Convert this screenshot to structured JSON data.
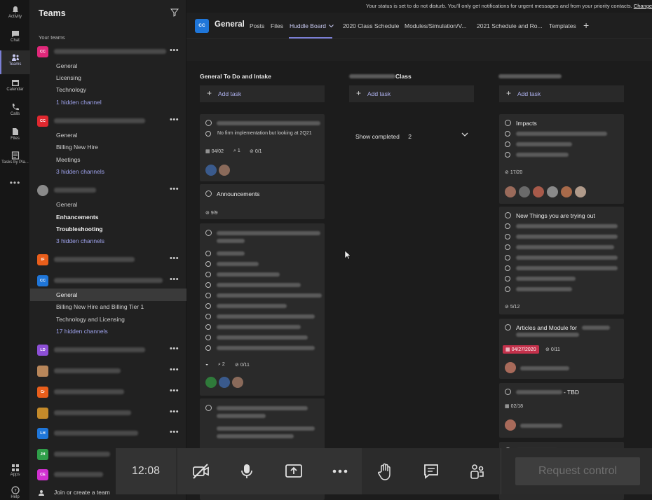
{
  "notification": {
    "text": "Your status is set to do not disturb. You'll only get notifications for urgent messages and from your priority contacts.",
    "link": "Change"
  },
  "rail": {
    "items": [
      {
        "label": "Activity",
        "icon": "bell-icon"
      },
      {
        "label": "Chat",
        "icon": "chat-icon"
      },
      {
        "label": "Teams",
        "icon": "teams-icon"
      },
      {
        "label": "Calendar",
        "icon": "calendar-icon"
      },
      {
        "label": "Calls",
        "icon": "phone-icon"
      },
      {
        "label": "Files",
        "icon": "file-icon"
      },
      {
        "label": "Tasks by Pla...",
        "icon": "tasks-icon"
      }
    ],
    "more": "•••",
    "apps": "Apps",
    "help": "Help"
  },
  "teams_panel": {
    "title": "Teams",
    "section": "Your teams",
    "teams": [
      {
        "initials": "CC",
        "color": "#e0287a"
      },
      {
        "initials": "CC",
        "color": "#e0282f"
      },
      {
        "initials": "",
        "color": "#8a8a8a"
      },
      {
        "initials": "IF",
        "color": "#e95e1b"
      },
      {
        "initials": "CC",
        "color": "#1f76d9"
      },
      {
        "initials": "LD",
        "color": "#8d4fd6"
      },
      {
        "initials": "",
        "color": "#b8865a"
      },
      {
        "initials": "Cr",
        "color": "#e95e1b"
      },
      {
        "initials": "",
        "color": "#c48a2a"
      },
      {
        "initials": "LH",
        "color": "#1f76d9"
      },
      {
        "initials": "JH",
        "color": "#2f9e49"
      },
      {
        "initials": "CE",
        "color": "#d12fd0"
      }
    ],
    "channels": {
      "t1": [
        "General",
        "Licensing",
        "Technology",
        "1 hidden channel"
      ],
      "t2": [
        "General",
        "Billing New Hire",
        "Meetings",
        "3 hidden channels"
      ],
      "t3": [
        "General",
        "Enhancements",
        "Troubleshooting",
        "3 hidden channels"
      ],
      "t5": [
        "General",
        "Billing New Hire and Billing Tier 1",
        "Technology and Licensing",
        "17 hidden channels"
      ]
    },
    "join": "Join or create a team"
  },
  "channel_header": {
    "avatar": "CC",
    "name": "General",
    "tabs": [
      "Posts",
      "Files",
      "Huddle Board",
      "2020 Class Schedule",
      "Modules/Simulation/V...",
      "2021 Schedule and Ro...",
      "Templates"
    ],
    "add": "+"
  },
  "board": {
    "columns": [
      {
        "title": "General To Do and Intake",
        "add_task": "Add task"
      },
      {
        "title": "Class",
        "add_task": "Add task"
      },
      {
        "title": "",
        "add_task": "Add task"
      }
    ],
    "col1_cards": {
      "c1_sub": "No firm implementation but looking at 2Q21",
      "c1_date": "04/02",
      "c1_attach": "1",
      "c1_check": "0/1",
      "c2_title": "Announcements",
      "c2_check": "9/9",
      "c3_attach": "2",
      "c3_check": "0/11"
    },
    "col2": {
      "show_completed": "Show completed",
      "count": "2"
    },
    "col3_cards": {
      "c1_title": "Impacts",
      "c1_check": "17/20",
      "c2_title": "New Things you are trying out",
      "c2_check": "5/12",
      "c3_title": "Articles and Module for",
      "c3_date": "04/27/2020",
      "c3_check": "0/11",
      "c4_title": "- TBD",
      "c4_date": "02/18"
    }
  },
  "meeting": {
    "time": "12:08",
    "request_control": "Request control"
  }
}
